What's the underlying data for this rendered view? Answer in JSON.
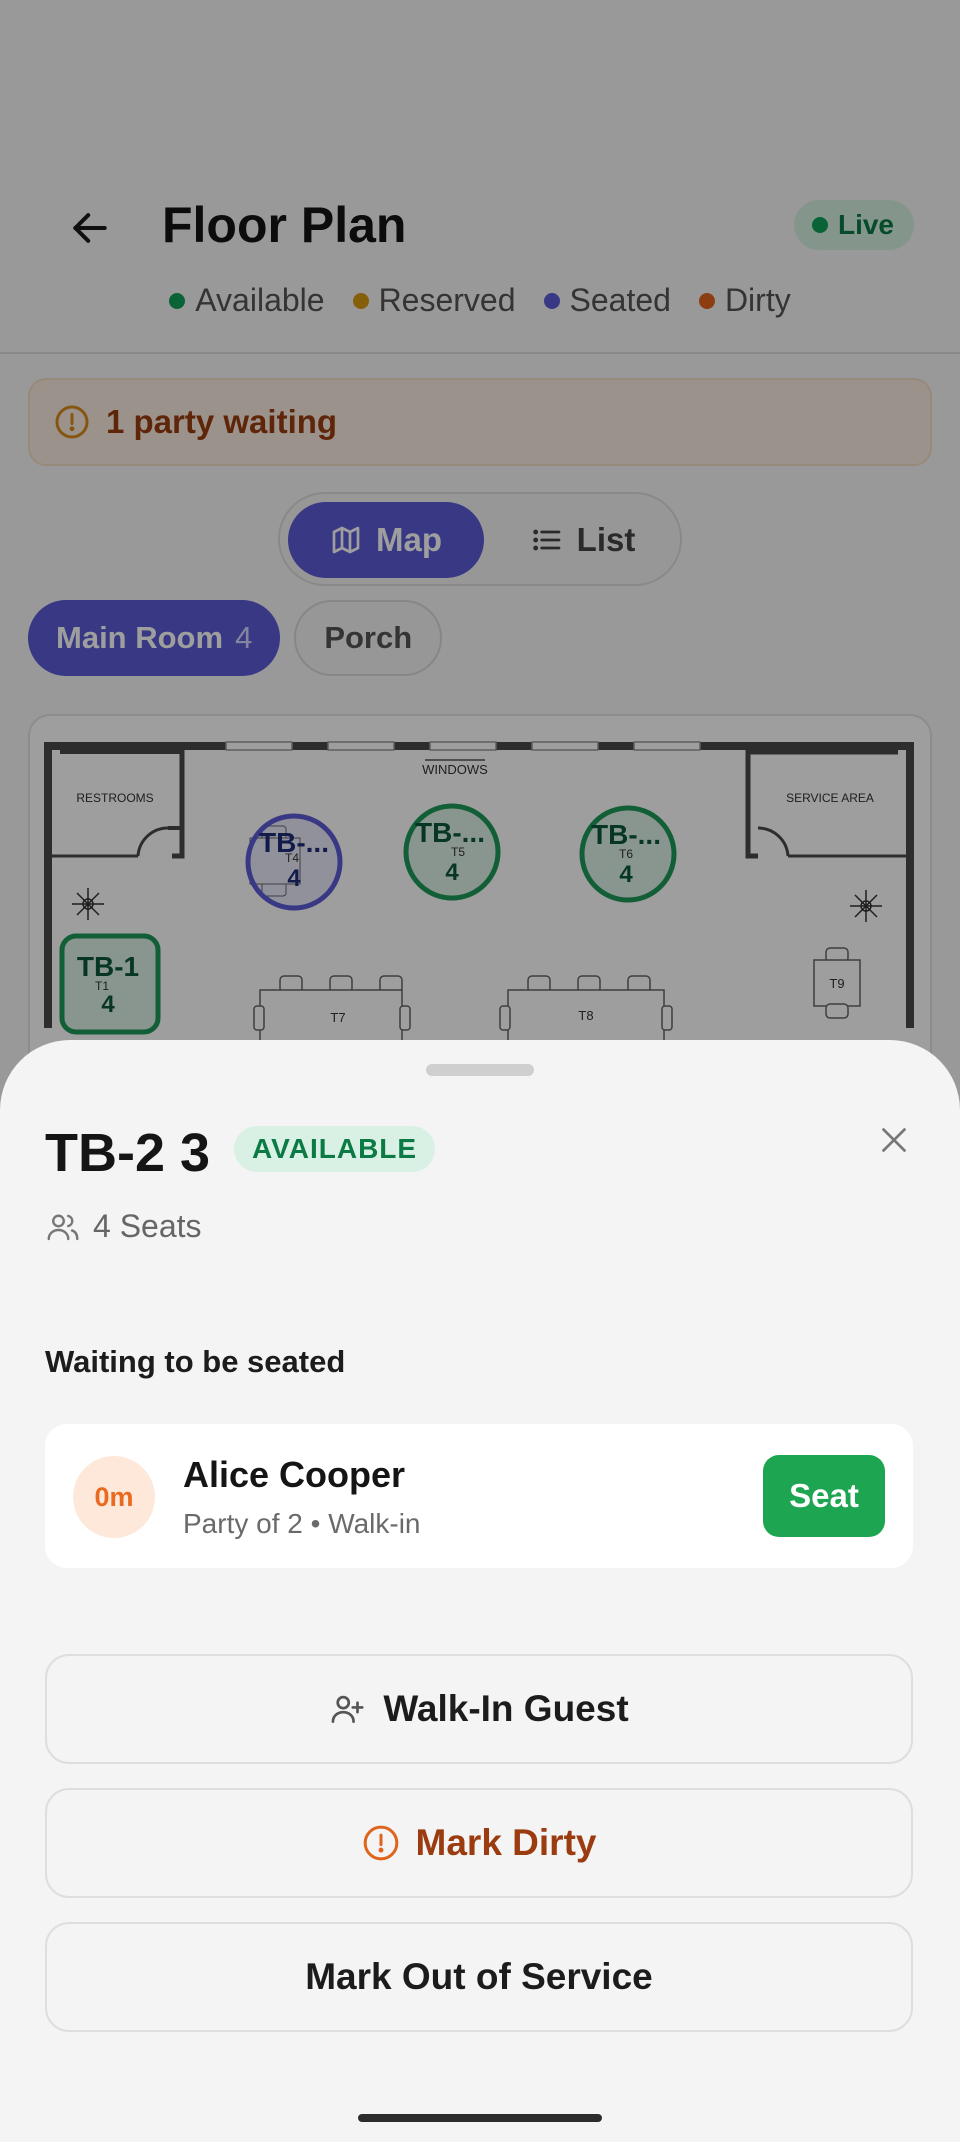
{
  "header": {
    "title": "Floor Plan",
    "live_label": "Live"
  },
  "legend": [
    {
      "label": "Available",
      "color": "#10a05a"
    },
    {
      "label": "Reserved",
      "color": "#d89a12"
    },
    {
      "label": "Seated",
      "color": "#5b5bd6"
    },
    {
      "label": "Dirty",
      "color": "#e0651c"
    }
  ],
  "waiting_banner": {
    "text": "1 party waiting"
  },
  "view_toggle": {
    "map_label": "Map",
    "list_label": "List"
  },
  "rooms": {
    "main": {
      "label": "Main Room",
      "count": "4"
    },
    "porch": {
      "label": "Porch"
    }
  },
  "floor_map": {
    "windows_label": "WINDOWS",
    "restrooms_label": "RESTROOMS",
    "service_label": "SERVICE AREA",
    "tables": [
      {
        "id": "TB-...",
        "sub": "T4",
        "seats": "4",
        "status": "seated"
      },
      {
        "id": "TB-...",
        "sub": "T5",
        "seats": "4",
        "status": "available"
      },
      {
        "id": "TB-...",
        "sub": "T6",
        "seats": "4",
        "status": "available"
      },
      {
        "id": "TB-1",
        "sub": "T1",
        "seats": "4",
        "status": "available"
      }
    ],
    "fixed_tables": {
      "t7": "T7",
      "t8": "T8",
      "t9": "T9"
    }
  },
  "sheet": {
    "table_name": "TB-2 3",
    "status_badge": "AVAILABLE",
    "seats_label": "4 Seats",
    "waiting_title": "Waiting to be seated",
    "guest": {
      "wait_time": "0m",
      "name": "Alice Cooper",
      "meta": "Party of 2 • Walk-in",
      "seat_label": "Seat"
    },
    "actions": {
      "walkin": "Walk-In Guest",
      "dirty": "Mark Dirty",
      "out_of_service": "Mark Out of Service"
    }
  },
  "colors": {
    "accent": "#5b5bd6",
    "available": "#10a05a",
    "seat_button": "#1ea552",
    "warning": "#e0651c"
  }
}
